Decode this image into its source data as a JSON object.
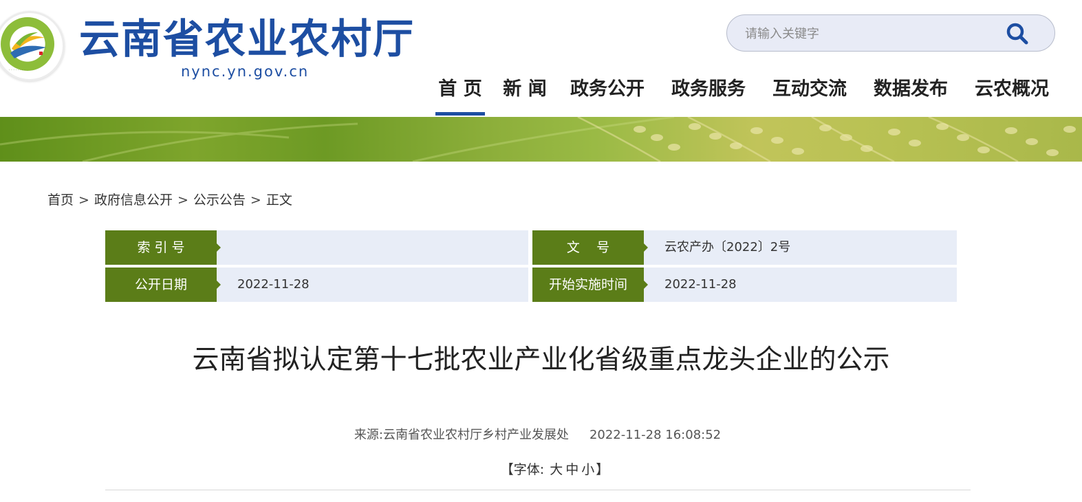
{
  "header": {
    "site_title": "云南省农业农村厅",
    "domain": "nync.yn.gov.cn",
    "logo_icon": "yunnan-agriculture-emblem",
    "search": {
      "placeholder": "请输入关键字",
      "icon": "search-icon"
    },
    "nav": [
      {
        "label": "首 页",
        "active": true
      },
      {
        "label": "新 闻"
      },
      {
        "label": "政务公开"
      },
      {
        "label": "政务服务"
      },
      {
        "label": "互动交流"
      },
      {
        "label": "数据发布"
      },
      {
        "label": "云农概况"
      }
    ]
  },
  "breadcrumb": {
    "items": [
      "首页",
      "政府信息公开",
      "公示公告",
      "正文"
    ],
    "separator": ">"
  },
  "meta": {
    "index_no": {
      "label": "索 引 号",
      "value": ""
    },
    "doc_no": {
      "label": "文    号",
      "value": "云农产办〔2022〕2号"
    },
    "publish_date": {
      "label": "公开日期",
      "value": "2022-11-28"
    },
    "effective_date": {
      "label": "开始实施时间",
      "value": "2022-11-28"
    }
  },
  "article": {
    "title": "云南省拟认定第十七批农业产业化省级重点龙头企业的公示",
    "source_label": "来源:",
    "source": "云南省农业农村厅乡村产业发展处",
    "datetime": "2022-11-28 16:08:52",
    "font_size": {
      "prefix": "【字体:",
      "options": [
        "大",
        "中",
        "小"
      ],
      "suffix": "】"
    }
  },
  "colors": {
    "brand_blue": "#1d4ea2",
    "label_green": "#5b7d18",
    "cell_bg": "#e8edf7",
    "search_bg": "#e8ebf6"
  }
}
